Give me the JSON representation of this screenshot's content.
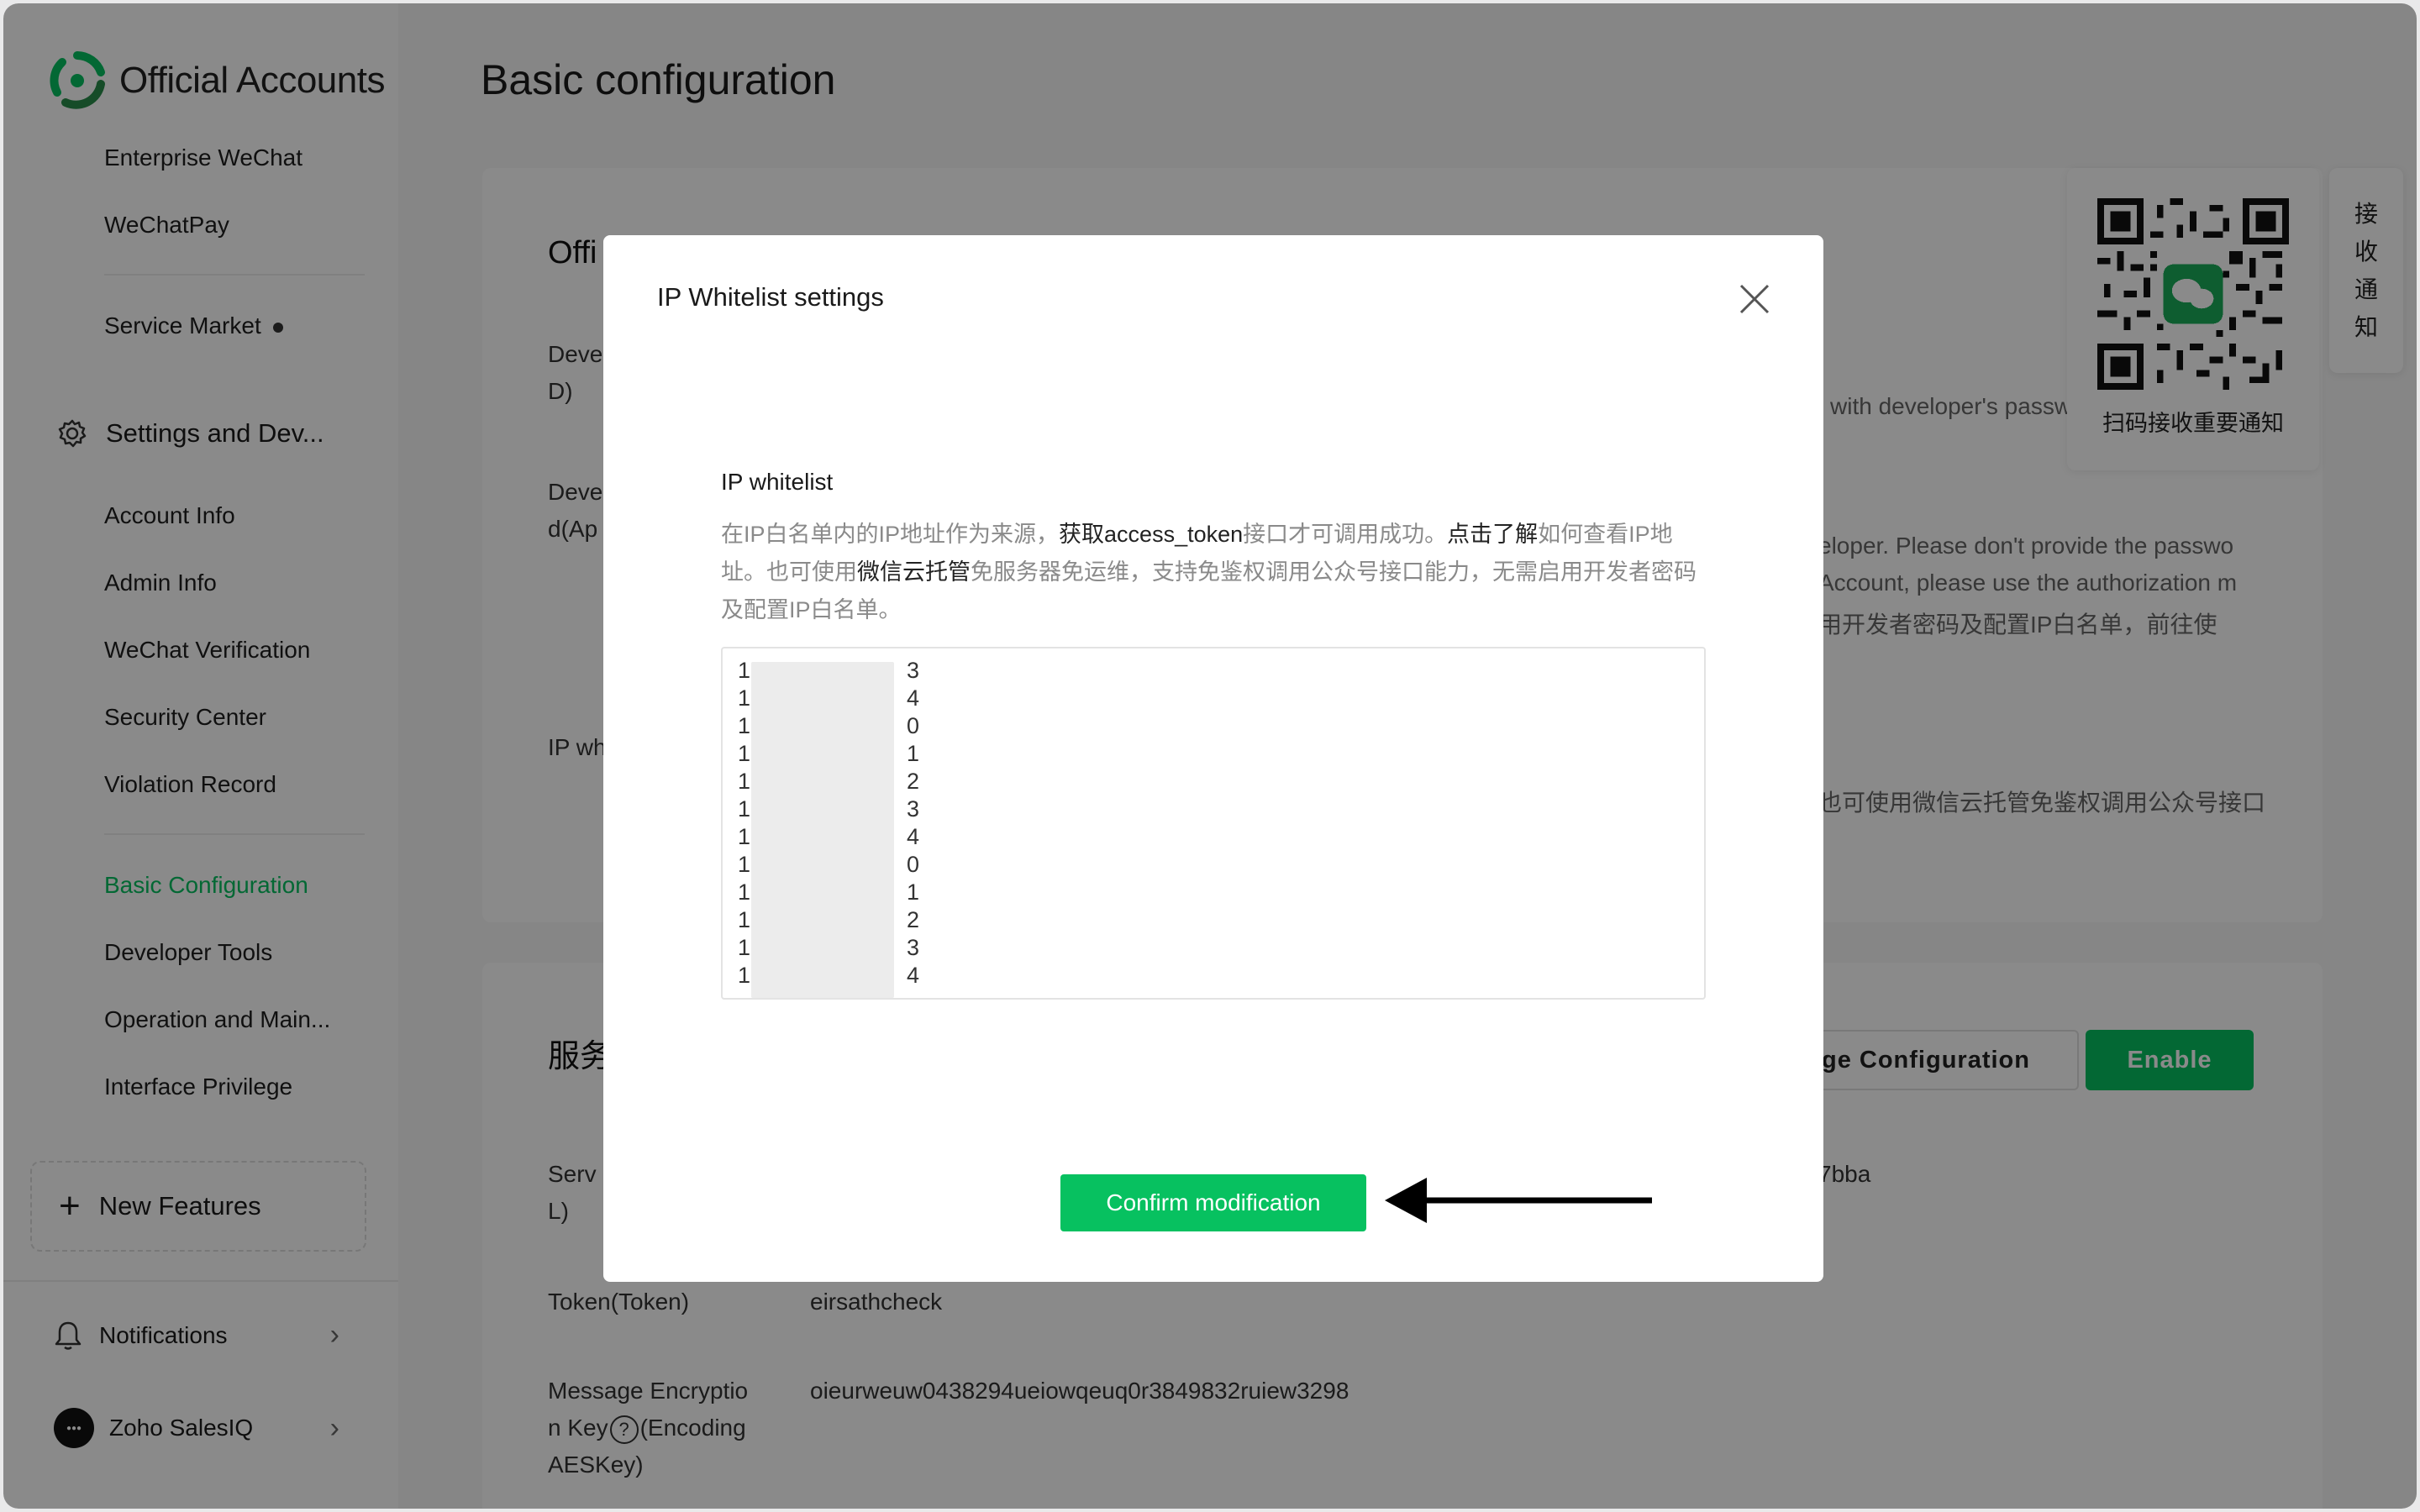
{
  "app": {
    "name": "Official Accounts",
    "page_title": "Basic configuration"
  },
  "sidebar": {
    "items_top": [
      {
        "label": "Enterprise WeChat"
      },
      {
        "label": "WeChatPay"
      },
      {
        "label": "Service Market"
      }
    ],
    "section": {
      "label": "Settings and Dev..."
    },
    "items_settings": [
      {
        "label": "Account Info"
      },
      {
        "label": "Admin Info"
      },
      {
        "label": "WeChat Verification"
      },
      {
        "label": "Security Center"
      },
      {
        "label": "Violation Record"
      }
    ],
    "items_dev": [
      {
        "label": "Basic Configuration",
        "active": true
      },
      {
        "label": "Developer Tools"
      },
      {
        "label": "Operation and Main..."
      },
      {
        "label": "Interface Privilege"
      }
    ],
    "new_features": "New Features",
    "notifications": "Notifications",
    "account": "Zoho SalesIQ"
  },
  "background": {
    "card1_heading": "Offi",
    "row_dev_id_a": "Deve",
    "row_dev_id_b": "D)",
    "row_dev_pw_a": "Deve",
    "row_dev_pw_b": "d(Ap",
    "row_ip": "IP wh",
    "hint_password": "l with developer's password",
    "hint_line1": "eloper. Please don't provide the passwo",
    "hint_line2": "Account, please use the authorization m",
    "hint_line3": "用开发者密码及配置IP白名单，前往使",
    "hint_ip": "也可使用微信云托管免鉴权调用公众号接口",
    "card2_heading": "服务",
    "server_a": "Serv",
    "server_b": "L)",
    "server_value": "7bba",
    "token_label": "Token(Token)",
    "token_value": "eirsathcheck",
    "aes_label_1": "Message Encryptio",
    "aes_label_2": "n Key",
    "aes_label_3": "(Encoding",
    "aes_label_4": "AESKey)",
    "aes_value": "oieurweuw0438294ueiowqeuq0r3849832ruiew3298",
    "manage_config": "ge Configuration",
    "enable": "Enable"
  },
  "qr": {
    "caption": "扫码接收重要通知",
    "side_tab": [
      "接",
      "收",
      "通",
      "知"
    ]
  },
  "dialog": {
    "title": "IP Whitelist settings",
    "field_label": "IP whitelist",
    "desc_1": "在IP白名单内的IP地址作为来源，",
    "desc_2": "获取access_token",
    "desc_3": "接口才可调用成功。",
    "desc_4": "点击了解",
    "desc_5": "如何查看IP地址。也可使用",
    "desc_6": "微信云托管",
    "desc_7": "免服务器免运维，支持免鉴权调用公众号接口能力，无需启用开发者密码及配置IP白名单。",
    "ip_lines": [
      {
        "start": "1",
        "end": "3"
      },
      {
        "start": "1",
        "end": "4"
      },
      {
        "start": "1",
        "end": "0"
      },
      {
        "start": "1",
        "end": "1"
      },
      {
        "start": "1",
        "end": "2"
      },
      {
        "start": "1",
        "end": "3"
      },
      {
        "start": "1",
        "end": "4"
      },
      {
        "start": "1",
        "end": "0"
      },
      {
        "start": "1",
        "end": "1"
      },
      {
        "start": "1",
        "end": "2"
      },
      {
        "start": "1",
        "end": "3"
      },
      {
        "start": "1",
        "end": "4"
      }
    ],
    "confirm": "Confirm modification"
  },
  "colors": {
    "brand_green": "#07c160",
    "overlay": "rgba(0,0,0,0.46)"
  },
  "icons": {
    "logo": "wechat-official-accounts-logo",
    "settings": "gear-icon",
    "close": "close-icon",
    "plus": "plus-icon",
    "bell": "bell-icon",
    "chevron": "chevron-right-icon",
    "arrow": "arrow-left-icon",
    "qr": "qr-code-icon"
  }
}
